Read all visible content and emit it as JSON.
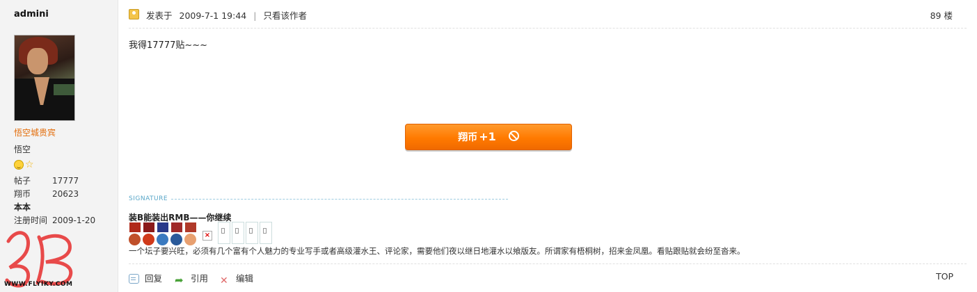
{
  "author": {
    "username": "admini",
    "rank": "悟空城贵宾",
    "nickname": "悟空",
    "stats": [
      {
        "label": "帖子",
        "value": "17777"
      },
      {
        "label": "翔币",
        "value": "20623"
      },
      {
        "label": "本本",
        "value": ""
      },
      {
        "label": "注册时间",
        "value": "2009-1-20"
      }
    ]
  },
  "site_logo_text": "WWW.FLYIKY.COM",
  "post": {
    "posted_label": "发表于",
    "posted_time": "2009-7-1 19:44",
    "separator": "|",
    "only_author": "只看该作者",
    "floor": "89 楼",
    "content": "我得17777贴~~~",
    "reward_label": "翔币",
    "reward_value": "+1"
  },
  "signature": {
    "label": "SIGNATURE",
    "title": "装B能装出RMB——你继续",
    "text": "一个坛子要兴旺，必须有几个富有个人魅力的专业写手或者高级灌水王、评论家，需要他们夜以继日地灌水以飨版友。所谓家有梧桐树，招来金凤凰。看贴跟贴就会纷至沓来。"
  },
  "actions": {
    "reply": "回复",
    "quote": "引用",
    "edit": "编辑",
    "top": "TOP"
  },
  "colors": {
    "rank": "#e36c09",
    "reward_button": "#ff7a00",
    "signature_label": "#58a6c8"
  }
}
